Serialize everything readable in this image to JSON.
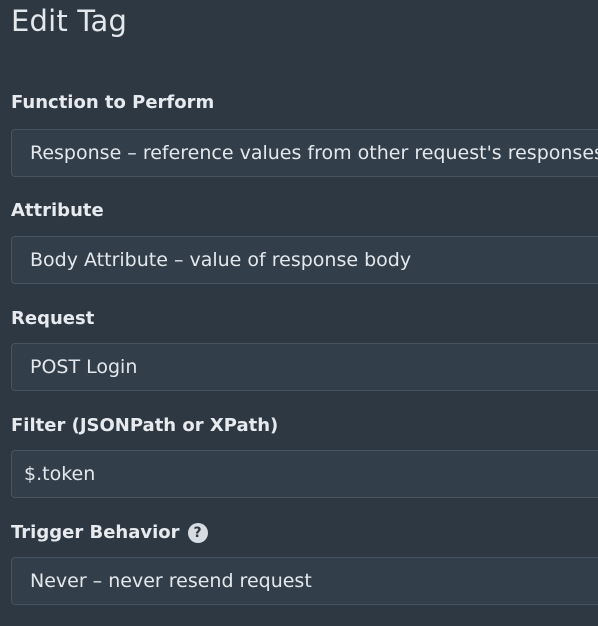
{
  "dialog": {
    "title": "Edit Tag"
  },
  "fields": {
    "function": {
      "label": "Function to Perform",
      "value": "Response – reference values from other request's responses"
    },
    "attribute": {
      "label": "Attribute",
      "value": "Body Attribute – value of response body"
    },
    "request": {
      "label": "Request",
      "value": "POST Login"
    },
    "filter": {
      "label": "Filter (JSONPath or XPath)",
      "value": "$.token"
    },
    "trigger": {
      "label": "Trigger Behavior",
      "help_icon": "question-circle-icon",
      "help_glyph": "?",
      "value": "Never – never resend request"
    }
  }
}
